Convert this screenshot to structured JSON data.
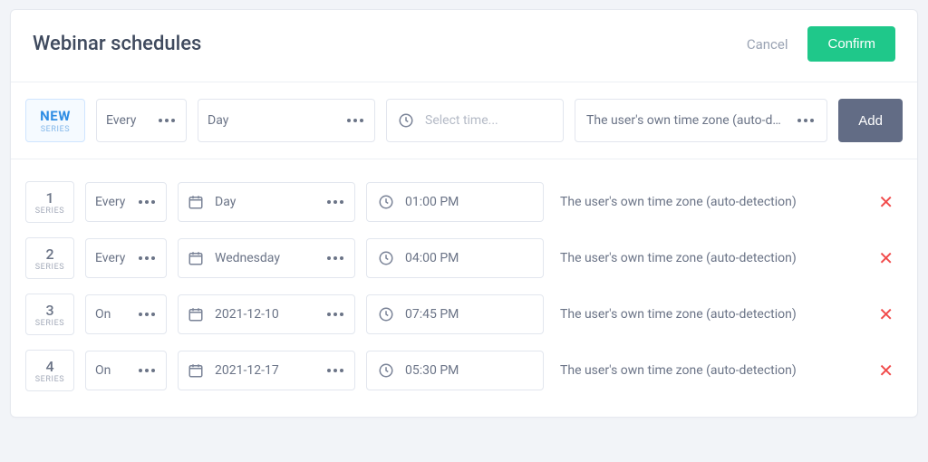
{
  "header": {
    "title": "Webinar schedules",
    "cancel": "Cancel",
    "confirm": "Confirm"
  },
  "builder": {
    "newBadge": {
      "top": "NEW",
      "bottom": "SERIES"
    },
    "every": "Every",
    "day": "Day",
    "timePlaceholder": "Select time...",
    "timezone": "The user's own time zone (auto-d…",
    "addLabel": "Add"
  },
  "seriesLabel": "SERIES",
  "rows": [
    {
      "idx": "1",
      "mode": "Every",
      "day": "Day",
      "time": "01:00 PM",
      "tz": "The user's own time zone (auto-detection)"
    },
    {
      "idx": "2",
      "mode": "Every",
      "day": "Wednesday",
      "time": "04:00 PM",
      "tz": "The user's own time zone (auto-detection)"
    },
    {
      "idx": "3",
      "mode": "On",
      "day": "2021-12-10",
      "time": "07:45 PM",
      "tz": "The user's own time zone (auto-detection)"
    },
    {
      "idx": "4",
      "mode": "On",
      "day": "2021-12-17",
      "time": "05:30 PM",
      "tz": "The user's own time zone (auto-detection)"
    }
  ]
}
